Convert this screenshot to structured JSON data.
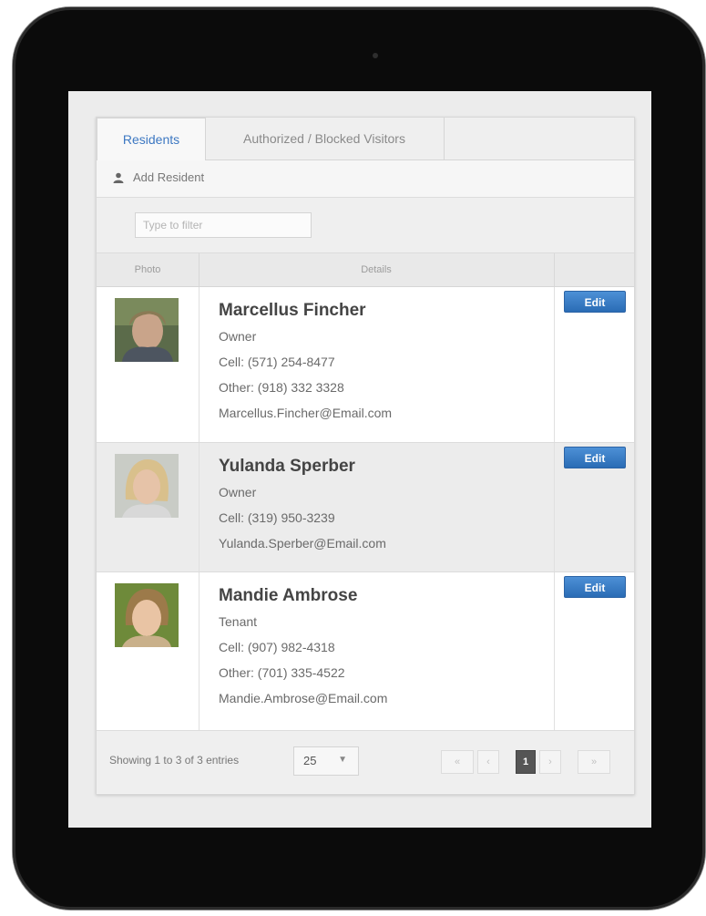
{
  "tabs": [
    {
      "label": "Residents",
      "active": true
    },
    {
      "label": "Authorized / Blocked Visitors",
      "active": false
    }
  ],
  "toolbar": {
    "add_label": "Add Resident",
    "icon": "user-icon"
  },
  "filter": {
    "placeholder": "Type to filter"
  },
  "table": {
    "columns": [
      "Photo",
      "Details",
      ""
    ],
    "rows": [
      {
        "name": "Marcellus Fincher",
        "role": "Owner",
        "cell": "Cell: (571) 254-8477",
        "other": "Other: (918) 332 3328",
        "email": "Marcellus.Fincher@Email.com",
        "edit_label": "Edit"
      },
      {
        "name": "Yulanda Sperber",
        "role": "Owner",
        "cell": "Cell: (319) 950-3239",
        "email": "Yulanda.Sperber@Email.com",
        "edit_label": "Edit"
      },
      {
        "name": "Mandie Ambrose",
        "role": "Tenant",
        "cell": "Cell: (907) 982-4318",
        "other": "Other: (701) 335-4522",
        "email": "Mandie.Ambrose@Email.com",
        "edit_label": "Edit"
      }
    ]
  },
  "footer": {
    "info": "Showing 1 to 3 of 3 entries",
    "page_size": "25",
    "pager": {
      "first": "«",
      "prev": "‹",
      "current": "1",
      "next": "›",
      "last": "»"
    }
  },
  "colors": {
    "accent": "#3d78c2",
    "edit_button": "#3a7bc8",
    "row_alt": "#ececec"
  }
}
